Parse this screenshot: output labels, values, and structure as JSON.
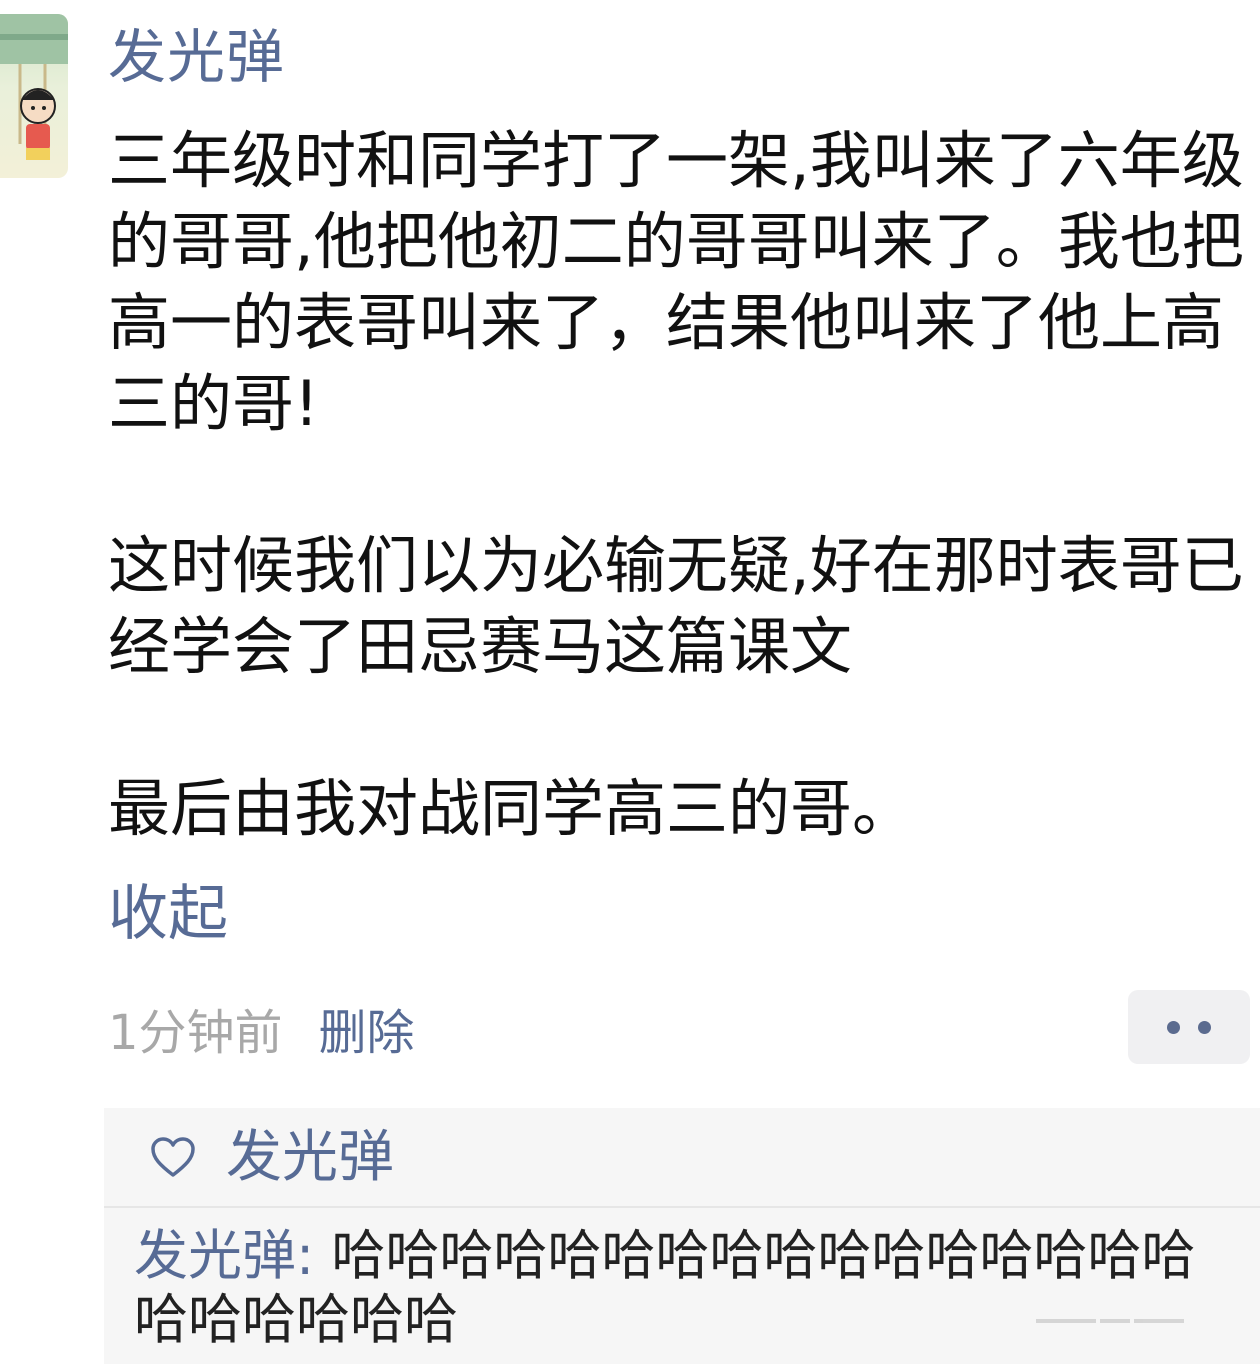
{
  "post": {
    "author": "发光弹",
    "paragraphs": [
      "三年级时和同学打了一架,我叫来了六年级的哥哥,他把他初二的哥哥叫来了。我也把高一的表哥叫来了，结果他叫来了他上高三的哥!",
      "这时候我们以为必输无疑,好在那时表哥已经学会了田忌赛马这篇课文",
      "最后由我对战同学高三的哥。"
    ],
    "collapse_label": "收起",
    "timestamp": "1分钟前",
    "delete_label": "删除"
  },
  "interactions": {
    "likes": [
      "发光弹"
    ],
    "comments": [
      {
        "author": "发光弹",
        "separator": ": ",
        "text": "哈哈哈哈哈哈哈哈哈哈哈哈哈哈哈哈哈哈哈哈哈哈"
      }
    ]
  },
  "icons": {
    "avatar": "cartoon-avatar-icon",
    "more": "more-dots-icon",
    "like": "heart-icon"
  },
  "colors": {
    "link": "#576b95",
    "text": "#111111",
    "muted": "#a8a8a8",
    "panel": "#f6f6f6"
  }
}
